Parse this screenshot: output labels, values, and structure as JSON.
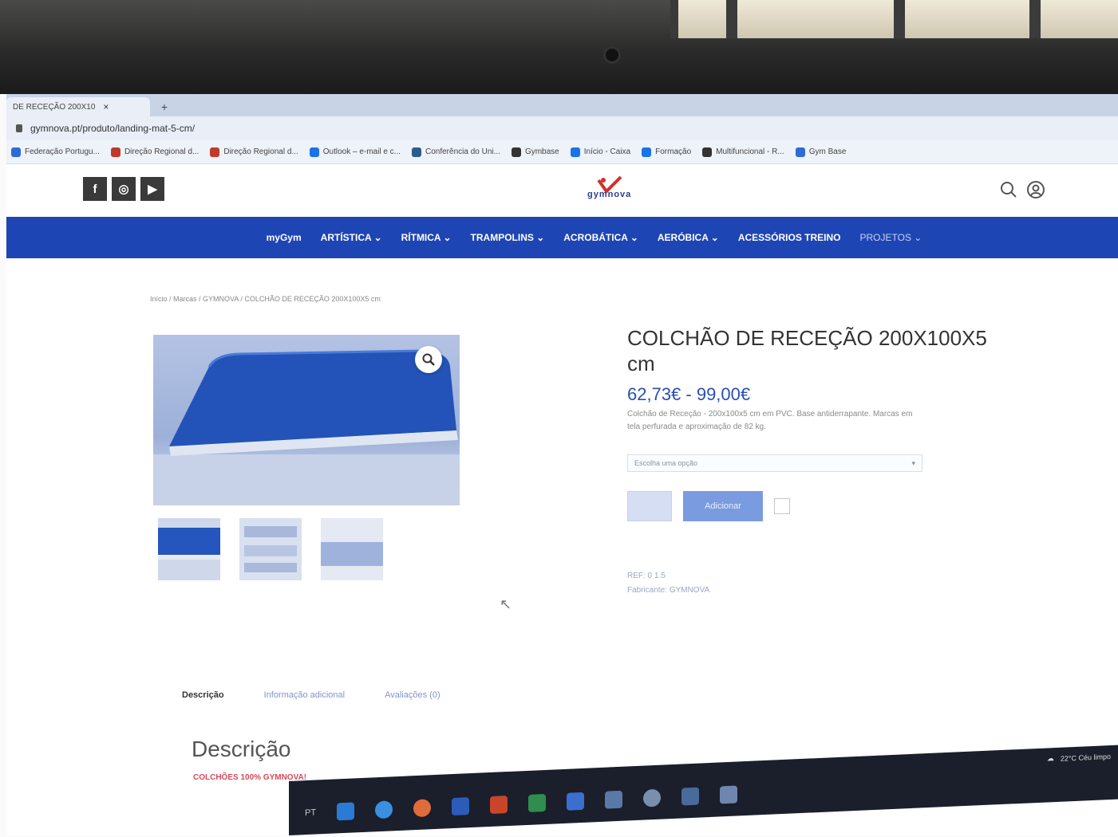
{
  "browser": {
    "tab_title": "DE RECEÇÃO 200X10",
    "tab_close": "×",
    "new_tab": "+",
    "url": "gymnova.pt/produto/landing-mat-5-cm/",
    "bookmarks": [
      {
        "label": "Federação Portugu...",
        "color": "#2d6bd6"
      },
      {
        "label": "Direção Regional d...",
        "color": "#c0392b"
      },
      {
        "label": "Direção Regional d...",
        "color": "#c0392b"
      },
      {
        "label": "Outlook – e-mail e c...",
        "color": "#1a73e8"
      },
      {
        "label": "Conferência do Uni...",
        "color": "#2d5e8a"
      },
      {
        "label": "Gymbase",
        "color": "#333333"
      },
      {
        "label": "Início - Caixa",
        "color": "#1a73e8"
      },
      {
        "label": "Formação",
        "color": "#1a73e8"
      },
      {
        "label": "Multifuncional - R...",
        "color": "#333333"
      },
      {
        "label": "Gym Base",
        "color": "#2d6bd6"
      }
    ]
  },
  "header": {
    "social": [
      {
        "icon": "facebook-icon",
        "glyph": "f"
      },
      {
        "icon": "instagram-icon",
        "glyph": "◎"
      },
      {
        "icon": "youtube-icon",
        "glyph": "▶"
      }
    ],
    "logo_text": "gymnova",
    "brand_color": "#1e45b4"
  },
  "nav": {
    "items": [
      {
        "label": "myGym"
      },
      {
        "label": "ARTÍSTICA ⌄"
      },
      {
        "label": "RÍTMICA ⌄"
      },
      {
        "label": "TRAMPOLINS ⌄"
      },
      {
        "label": "ACROBÁTICA ⌄"
      },
      {
        "label": "AERÓBICA ⌄"
      },
      {
        "label": "ACESSÓRIOS TREINO"
      },
      {
        "label": "PROJETOS ⌄"
      }
    ]
  },
  "breadcrumb": "Início / Marcas / GYMNOVA / COLCHÃO DE RECEÇÃO 200X100X5 cm",
  "product": {
    "title": "COLCHÃO DE RECEÇÃO 200X100X5 cm",
    "price": "62,73€ - 99,00€",
    "short_desc_line1": "Colchão de Receção - 200x100x5 cm em PVC. Base antiderrapante. Marcas em",
    "short_desc_line2": "tela perfurada e aproximação de 82 kg.",
    "select_placeholder": "Escolha uma opção",
    "add_to_cart": "Adicionar",
    "sku": "REF: 0 1.5",
    "category": "Fabricante: GYMNOVA"
  },
  "tabs": [
    {
      "label": "Descrição"
    },
    {
      "label": "Informação adicional"
    },
    {
      "label": "Avaliações (0)"
    }
  ],
  "description": {
    "heading": "Descrição",
    "subheading": "COLCHÕES 100% GYMNOVA!"
  },
  "taskbar": {
    "lang": "PT",
    "tray": "22°C  Céu limpo"
  }
}
